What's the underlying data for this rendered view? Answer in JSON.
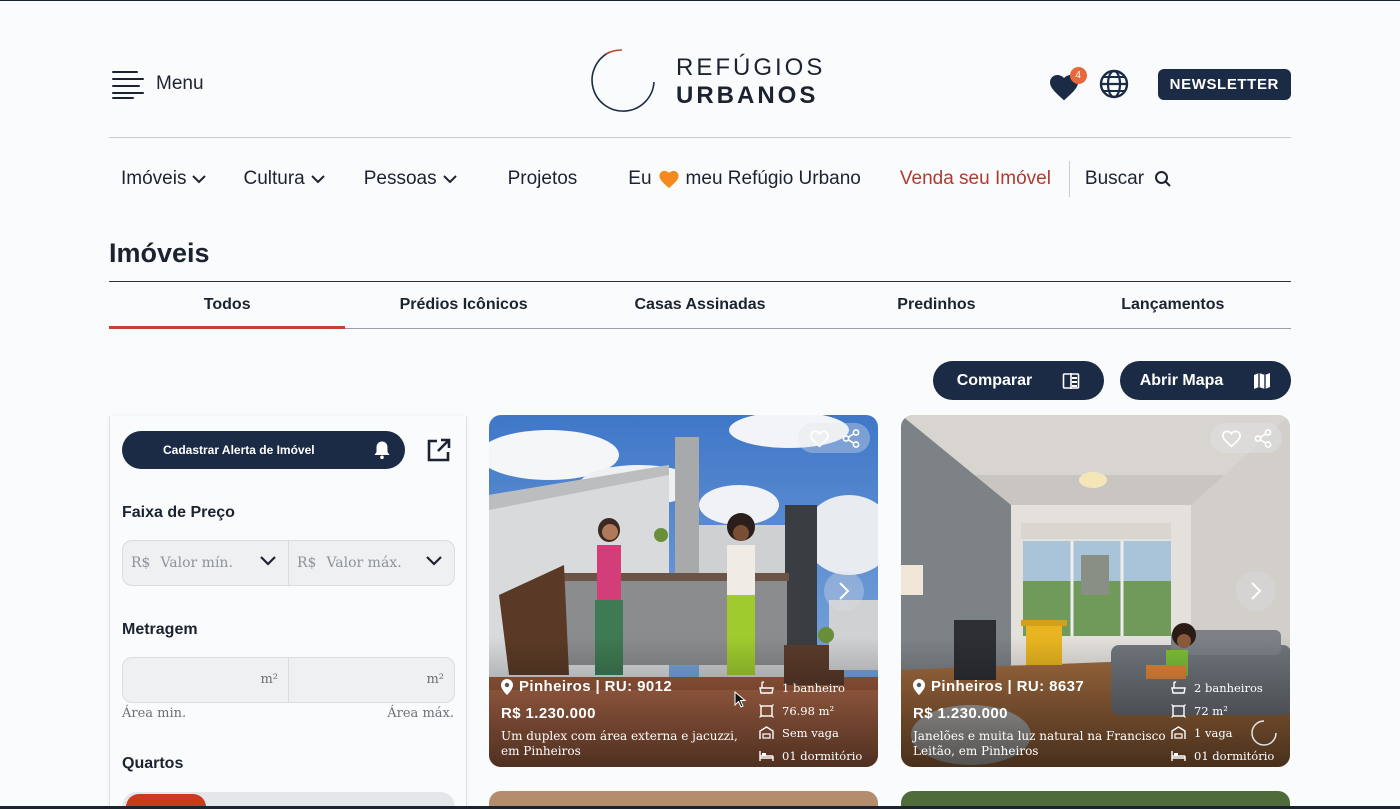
{
  "header": {
    "menu_label": "Menu",
    "logo_line1": "REFÚGIOS",
    "logo_line2": "URBANOS",
    "favorites_count": "4",
    "newsletter_label": "NEWSLETTER"
  },
  "nav": {
    "imoveis": "Imóveis",
    "cultura": "Cultura",
    "pessoas": "Pessoas",
    "projetos": "Projetos",
    "eu_prefix": "Eu",
    "eu_suffix": "meu Refúgio Urbano",
    "venda": "Venda seu Imóvel",
    "buscar": "Buscar"
  },
  "page_title": "Imóveis",
  "tabs": [
    "Todos",
    "Prédios Icônicos",
    "Casas Assinadas",
    "Predinhos",
    "Lançamentos"
  ],
  "actions": {
    "comparar": "Comparar",
    "abrir_mapa": "Abrir Mapa"
  },
  "filters": {
    "alert_button": "Cadastrar Alerta de Imóvel",
    "price_label": "Faixa de Preço",
    "currency": "R$",
    "min_placeholder": "Valor mín.",
    "max_placeholder": "Valor máx.",
    "area_label": "Metragem",
    "area_unit": "m²",
    "area_min_hint": "Área min.",
    "area_max_hint": "Área máx.",
    "rooms_label": "Quartos"
  },
  "cards": [
    {
      "location": "Pinheiros | RU: 9012",
      "price": "R$ 1.230.000",
      "description": "Um duplex com área externa e jacuzzi, em Pinheiros",
      "bathrooms": "1 banheiro",
      "area": "76.98 m²",
      "parking": "Sem vaga",
      "bedrooms": "01 dormitório"
    },
    {
      "location": "Pinheiros | RU: 8637",
      "price": "R$ 1.230.000",
      "description": "Janelões e muita luz natural na Francisco Leitão, em Pinheiros",
      "bathrooms": "2 banheiros",
      "area": "72 m²",
      "parking": "1 vaga",
      "bedrooms": "01 dormitório"
    }
  ],
  "colors": {
    "navy": "#1c2b45",
    "accent_red": "#b03a2e",
    "badge": "#e7683a"
  }
}
